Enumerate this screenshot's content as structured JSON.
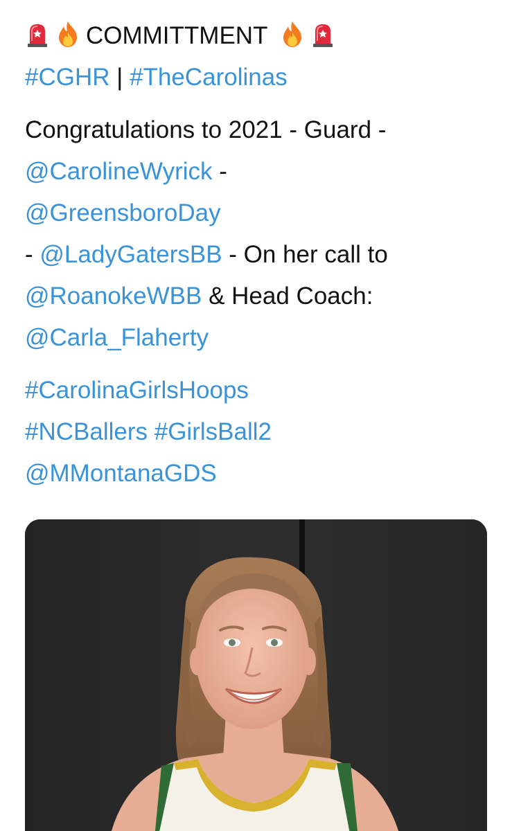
{
  "tweet": {
    "header_title": "COMMITTMENT",
    "header_icons_left": [
      "siren-icon",
      "fire-icon"
    ],
    "header_icons_right": [
      "fire-icon",
      "siren-icon"
    ],
    "hashtag_cghr": "#CGHR",
    "separator": " | ",
    "hashtag_carolinas": "#TheCarolinas",
    "congrats_text": "Congratulations to 2021 - Guard -",
    "mention_player": "@CarolineWyrick",
    "dash_after_player": " -",
    "mention_school": "@GreensboroDay",
    "dash_before_club": "- ",
    "mention_club": "@LadyGatersBB",
    "call_text": " - On her call to",
    "mention_college": "@RoanokeWBB",
    "head_coach_text": " & Head Coach:",
    "mention_coach": "@Carla_Flaherty",
    "hashtag_carolina_girls": "#CarolinaGirlsHoops",
    "hashtag_ncballers": "#NCBallers",
    "hashtag_girlsball": "#GirlsBall2",
    "mention_montana": "@MMontanaGDS"
  },
  "colors": {
    "link": "#3a92d8",
    "text": "#111111",
    "background": "#ffffff",
    "photo_wall": "#2b2b2b"
  }
}
